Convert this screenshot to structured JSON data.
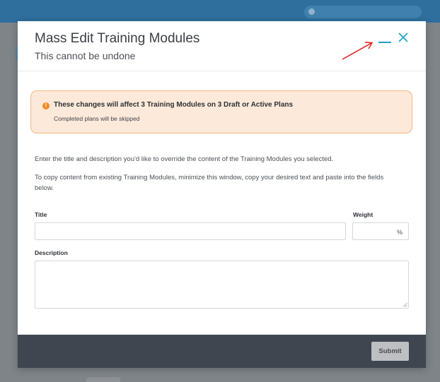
{
  "modal": {
    "title": "Mass Edit Training Modules",
    "subtitle": "This cannot be undone"
  },
  "alert": {
    "icon": "exclamation-icon",
    "title": "These changes will affect 3 Training Modules on 3 Draft or Active Plans",
    "subtext": "Completed plans will be skipped",
    "bg_color": "#fde9d9",
    "border_color": "#f4b886",
    "icon_color": "#f08a24"
  },
  "instructions": {
    "line1": "Enter the title and description you'd like to override the content of the Training Modules you selected.",
    "line2": "To copy content from existing Training Modules, minimize this window, copy your desired text and paste into the fields below."
  },
  "form": {
    "title_label": "Title",
    "title_value": "",
    "weight_label": "Weight",
    "weight_value": "",
    "weight_suffix": "%",
    "description_label": "Description",
    "description_value": ""
  },
  "footer": {
    "submit_label": "Submit"
  },
  "colors": {
    "accent": "#1aa3c4",
    "annotation_arrow": "#e0201c",
    "footer_bg": "#3f4650"
  }
}
